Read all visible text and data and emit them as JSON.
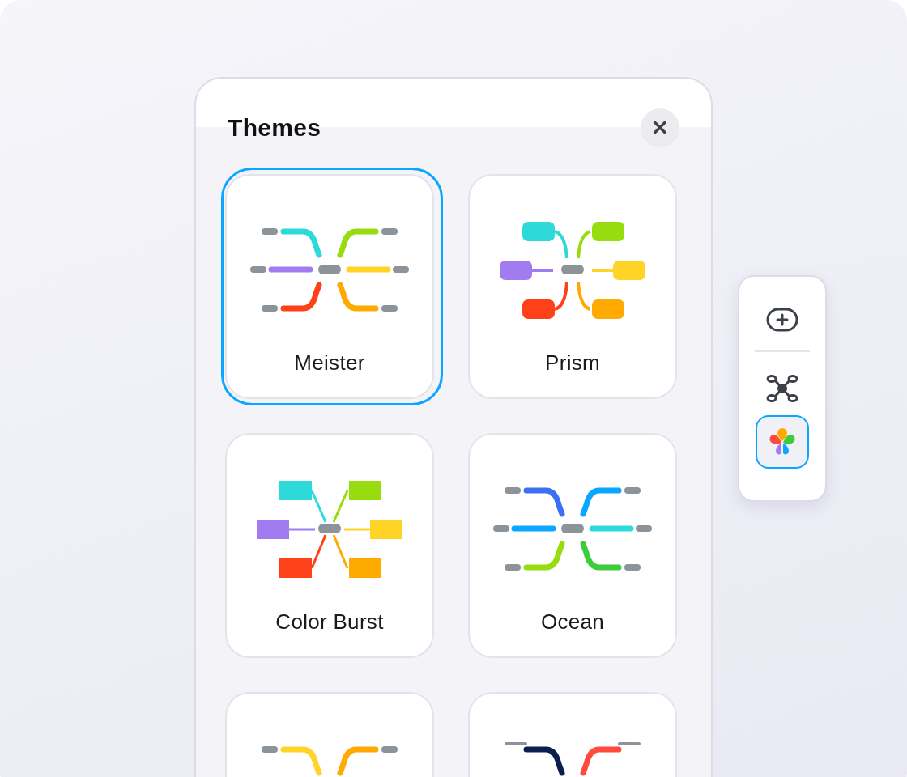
{
  "panel": {
    "title": "Themes",
    "close_label": "✕"
  },
  "themes": [
    {
      "label": "Meister",
      "selected": true,
      "kind": "meister"
    },
    {
      "label": "Prism",
      "selected": false,
      "kind": "prism"
    },
    {
      "label": "Color Burst",
      "selected": false,
      "kind": "burst"
    },
    {
      "label": "Ocean",
      "selected": false,
      "kind": "ocean"
    },
    {
      "selected": false,
      "kind": "sunny"
    },
    {
      "selected": false,
      "kind": "navy"
    }
  ],
  "toolbar": {
    "items": [
      {
        "kind": "add",
        "selected": false
      },
      {
        "kind": "layout",
        "selected": false
      },
      {
        "kind": "theme",
        "selected": true
      }
    ]
  }
}
